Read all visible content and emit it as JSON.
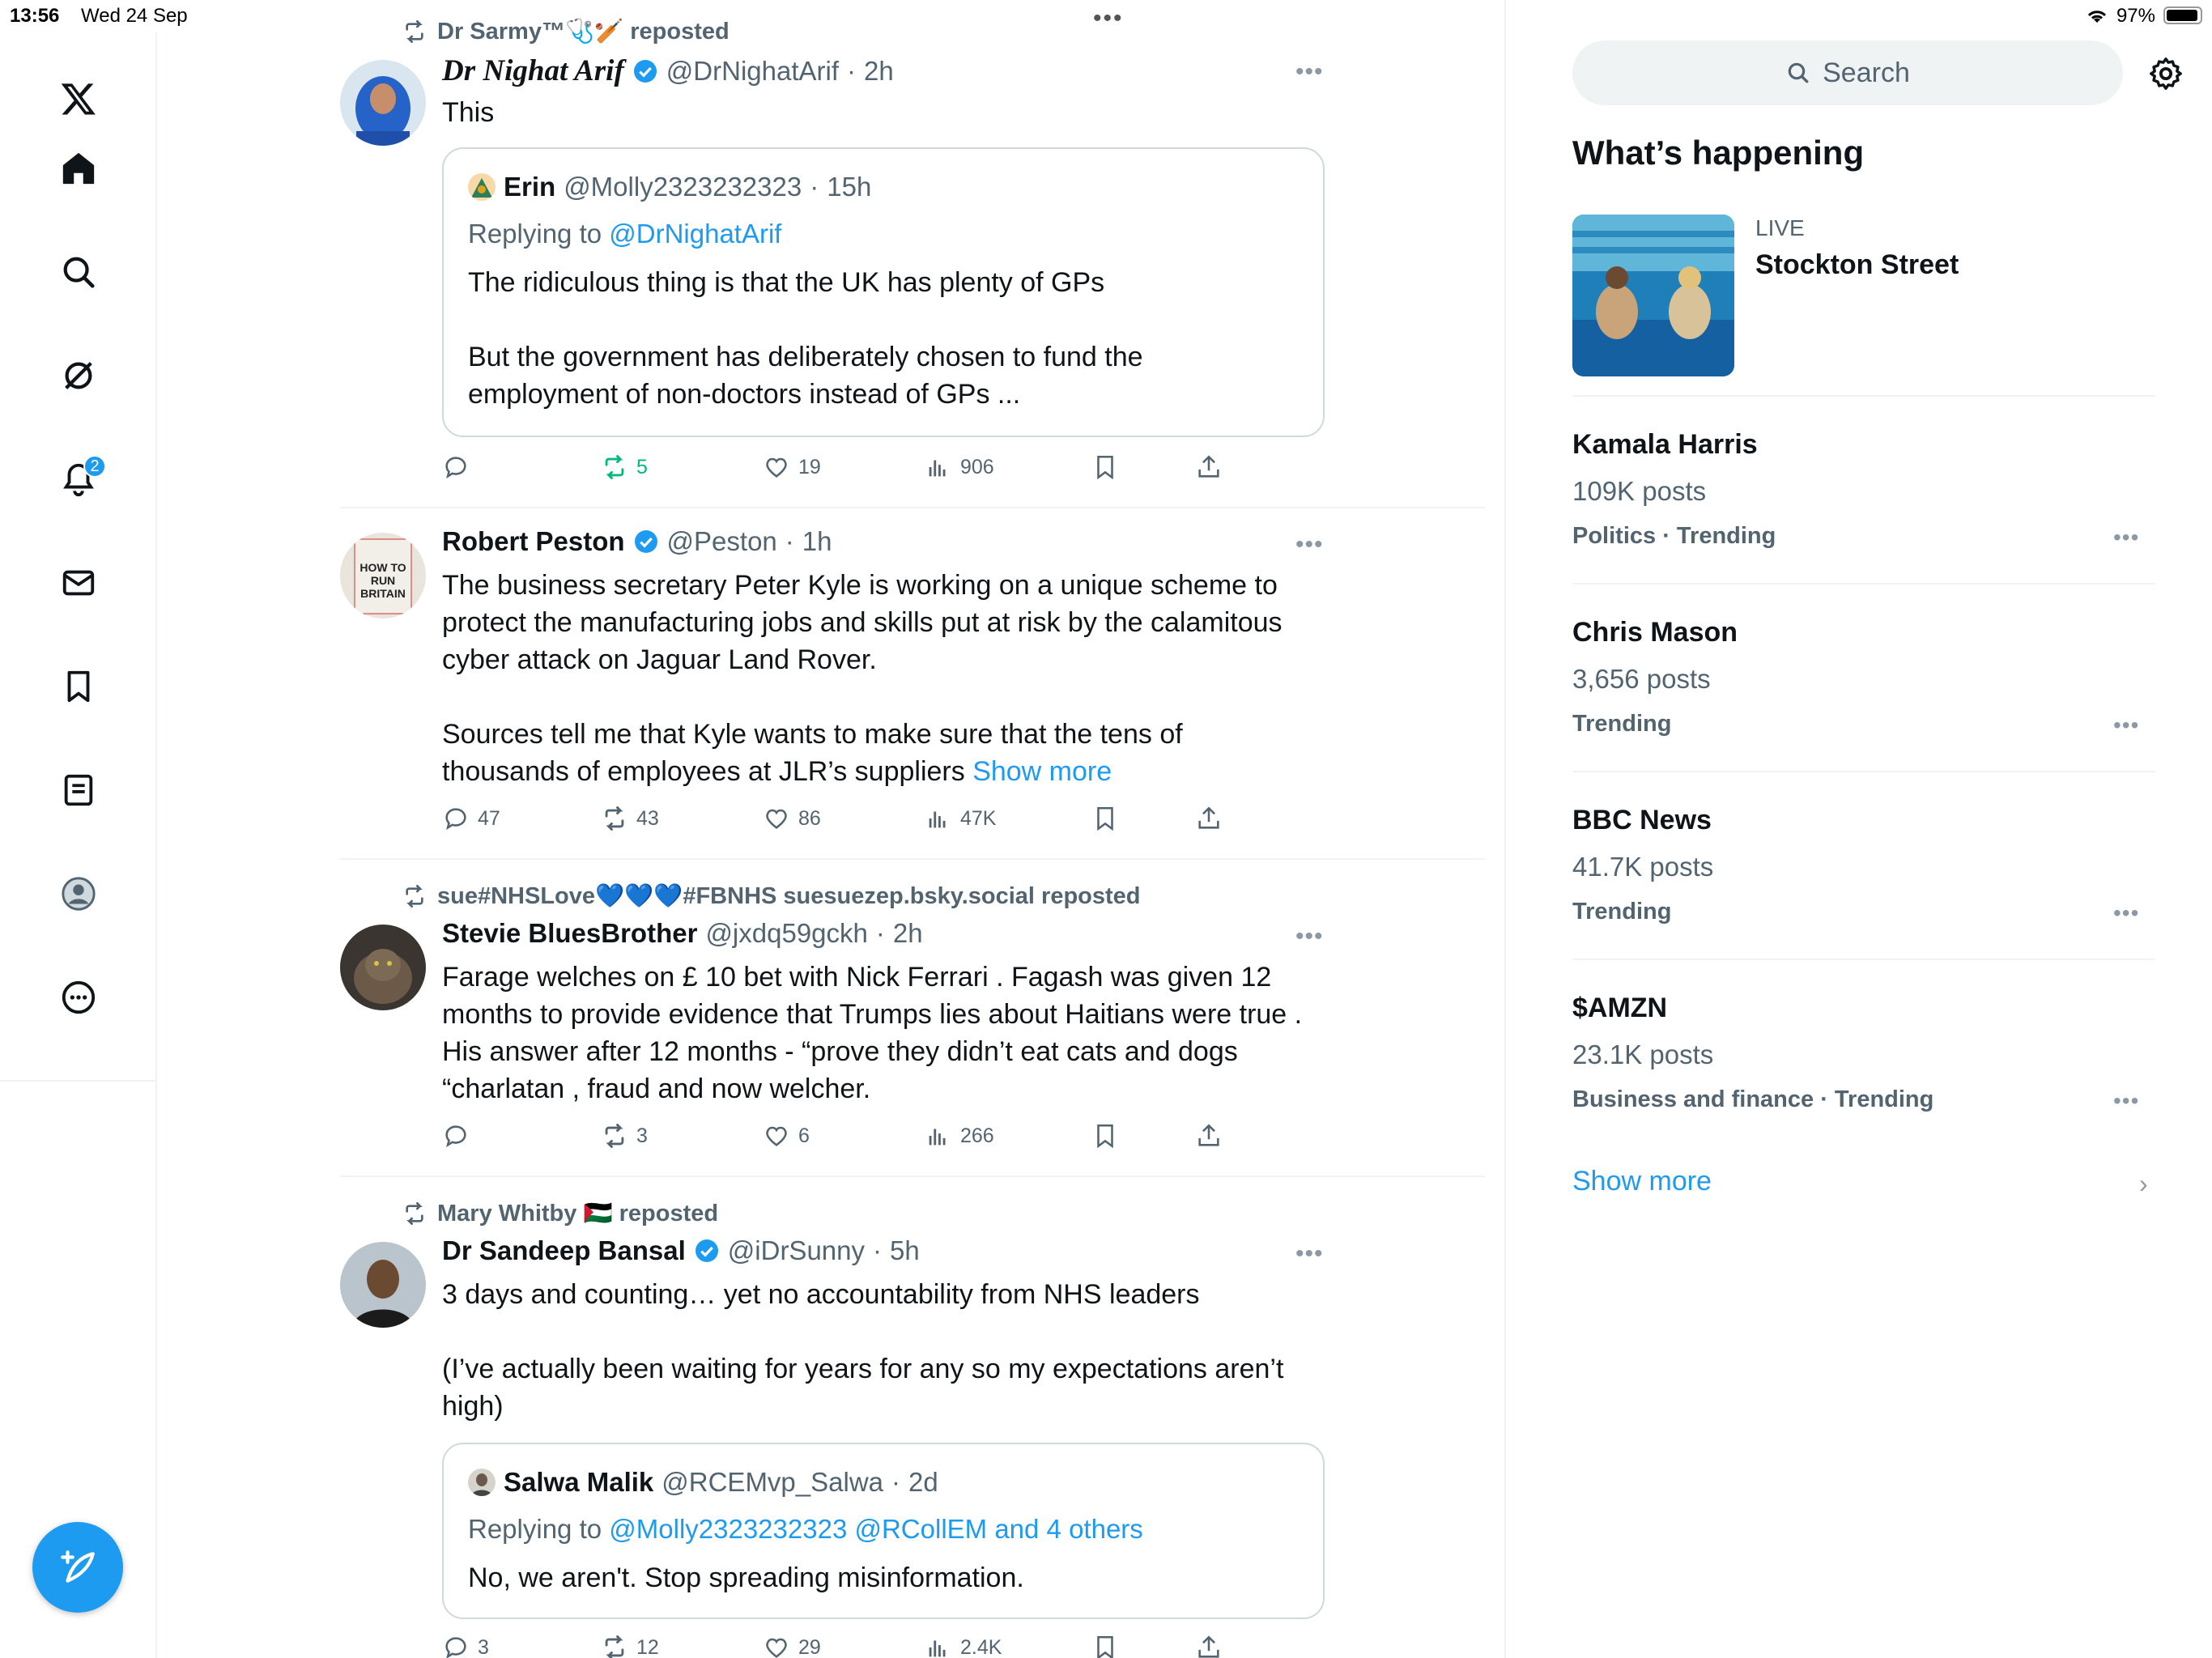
{
  "status_bar": {
    "time": "13:56",
    "date": "Wed 24 Sep",
    "battery": "97%"
  },
  "top_menu_dots": "•••",
  "nav": {
    "notifications_badge": "2",
    "items": [
      "x-logo",
      "home",
      "explore",
      "grok",
      "notifications",
      "messages",
      "bookmarks",
      "lists",
      "profile",
      "more"
    ],
    "compose_icon": "compose-icon"
  },
  "tweets": [
    {
      "repost_by": "Dr Sarmy™🩺🏏 reposted",
      "name": "Dr Nighat Arif",
      "handle": "@DrNighatArif",
      "time": "2h",
      "dot": "·",
      "text": "This",
      "quote": {
        "name": "Erin",
        "handle": "@Molly2323232323",
        "time": "15h",
        "replying_prefix": "Replying to ",
        "replying_to": "@DrNighatArif",
        "text": "The ridiculous thing is that the UK has plenty of GPs\n\nBut the government has deliberately chosen to fund the\nemployment of non-doctors instead of GPs ..."
      },
      "stats": {
        "replies": "",
        "reposts": "5",
        "likes": "19",
        "views": "906"
      }
    },
    {
      "name": "Robert Peston",
      "handle": "@Peston",
      "time": "1h",
      "dot": "·",
      "text": "The business secretary Peter Kyle is working on a unique scheme to\nprotect the manufacturing jobs and skills put at risk by the calamitous\ncyber attack on Jaguar Land Rover.\n\nSources tell me that Kyle wants to make sure that the tens of\nthousands of employees at JLR’s suppliers ",
      "show_more": "Show more",
      "avatar_text": "HOW TO RUN BRITAIN",
      "stats": {
        "replies": "47",
        "reposts": "43",
        "likes": "86",
        "views": "47K"
      }
    },
    {
      "repost_by": "sue#NHSLove💙💙💙#FBNHS suesuezep.bsky.social reposted",
      "name": "Stevie BluesBrother",
      "handle": "@jxdq59gckh",
      "time": "2h",
      "dot": "·",
      "text": "Farage welches on £ 10 bet with Nick Ferrari . Fagash was given 12\nmonths to provide evidence that Trumps lies about Haitians were true .\nHis answer after 12 months - “prove they didn’t eat cats  and dogs\n“charlatan , fraud and now welcher.",
      "stats": {
        "replies": "",
        "reposts": "3",
        "likes": "6",
        "views": "266"
      }
    },
    {
      "repost_by": "Mary Whitby 🇵🇸 reposted",
      "name": "Dr Sandeep Bansal",
      "handle": "@iDrSunny",
      "time": "5h",
      "dot": "·",
      "text": "3 days and counting… yet no accountability from NHS leaders\n\n(I’ve actually been waiting for years for any so my expectations aren’t\nhigh)",
      "quote": {
        "name": "Salwa Malik",
        "handle": "@RCEMvp_Salwa",
        "time": "2d",
        "replying_prefix": "Replying to ",
        "replying_to": "@Molly2323232323 @RCollEM and 4 others",
        "text": "No, we aren't. Stop spreading misinformation."
      },
      "stats": {
        "replies": "3",
        "reposts": "12",
        "likes": "29",
        "views": "2.4K"
      }
    }
  ],
  "sidebar": {
    "search_placeholder": "Search",
    "whats_happening": "What’s happening",
    "live": {
      "label": "LIVE",
      "title": "Stockton Street"
    },
    "trends": [
      {
        "name": "Kamala Harris",
        "posts": "109K posts",
        "category": "Politics · Trending"
      },
      {
        "name": "Chris Mason",
        "posts": "3,656 posts",
        "category": "Trending"
      },
      {
        "name": "BBC News",
        "posts": "41.7K posts",
        "category": "Trending"
      },
      {
        "name": "$AMZN",
        "posts": "23.1K posts",
        "category": "Business and finance · Trending"
      }
    ],
    "more_dots": "•••",
    "show_more": "Show more",
    "chevron": "›"
  },
  "colors": {
    "accent": "#1d9bf0",
    "repost_green": "#00ba7c",
    "muted": "#536471"
  }
}
